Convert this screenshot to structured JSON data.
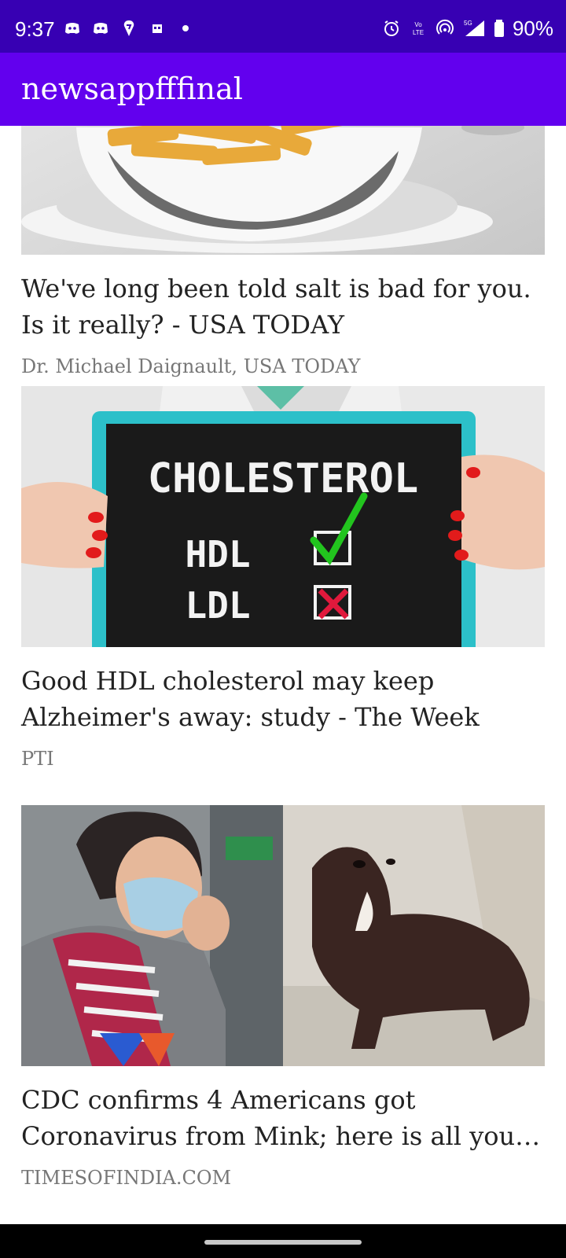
{
  "status_bar": {
    "time": "9:37",
    "battery": "90%",
    "network": "5G",
    "volte": "Vo LTE",
    "icons_left": [
      "discord-icon",
      "discord-icon",
      "swiggy-icon",
      "calendar-icon",
      "dot-icon"
    ],
    "icons_right": [
      "alarm-icon",
      "volte-icon",
      "hotspot-icon",
      "signal-icon",
      "battery-icon"
    ]
  },
  "app_bar": {
    "title": "newsappfffinal",
    "color": "#6200ee",
    "status_color": "#3700b3"
  },
  "articles": [
    {
      "image": "bowl-of-fries",
      "title": "We've long been told salt is bad for you. Is it really? - USA TODAY",
      "source": "Dr. Michael Daignault, USA TODAY"
    },
    {
      "image": "cholesterol-chalkboard",
      "board_text": [
        "CHOLESTEROL",
        "HDL",
        "LDL"
      ],
      "title": "Good HDL cholesterol may keep Alzheimer's away: study - The Week",
      "source": "PTI"
    },
    {
      "image": "masked-woman-and-mink",
      "title_line1": "CDC confirms 4 Americans got",
      "title_line2": "Coronavirus from Mink; here is all you need to know",
      "source": "TIMESOFINDIA.COM"
    }
  ]
}
